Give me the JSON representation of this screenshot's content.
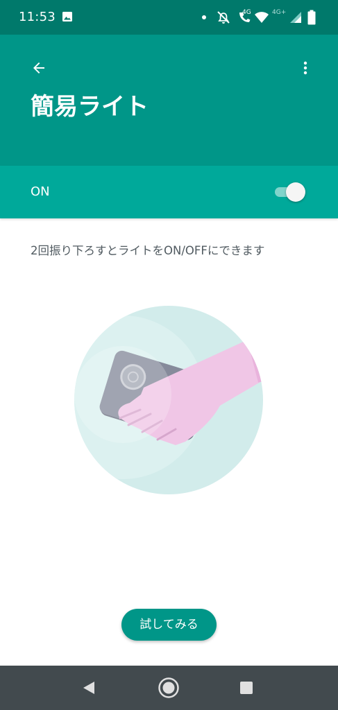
{
  "status_bar": {
    "time": "11:53",
    "volte_label": "4G",
    "network_label": "4G+",
    "icons": [
      "image-icon",
      "dot-icon",
      "notifications-off-icon",
      "volte-call-icon",
      "wifi-icon",
      "signal-icon",
      "battery-icon"
    ]
  },
  "app_bar": {
    "title": "簡易ライト",
    "back_icon": "arrow-back-icon",
    "menu_icon": "more-vert-icon"
  },
  "master_switch": {
    "label": "ON",
    "checked": true
  },
  "content": {
    "description": "2回振り下ろすとライトをON/OFFにできます"
  },
  "actions": {
    "try_label": "試してみる"
  },
  "nav_bar": {
    "icons": [
      "back-triangle-icon",
      "home-circle-icon",
      "recents-square-icon"
    ]
  },
  "colors": {
    "status_bar": "#00796b",
    "app_bar": "#009688",
    "switch_bar": "#00a99a",
    "accent": "#009688",
    "nav_bar": "#424a4e"
  }
}
